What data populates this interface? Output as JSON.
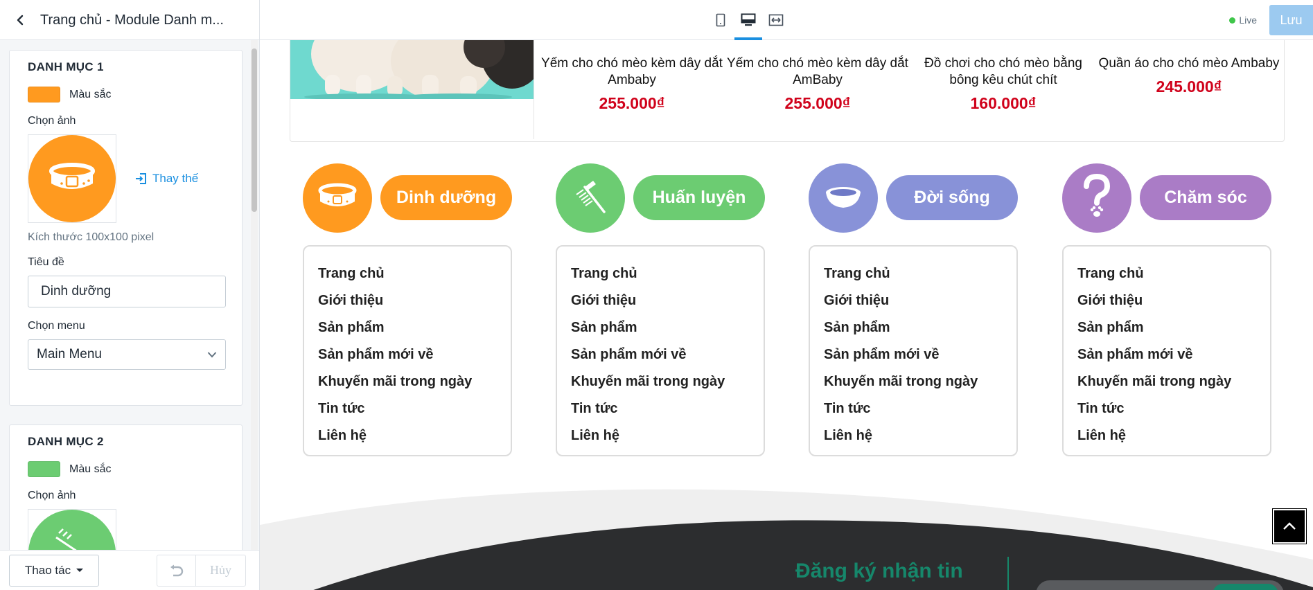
{
  "topbar": {
    "title": "Trang chủ - Module Danh m...",
    "live_label": "Live",
    "save_label": "Lưu"
  },
  "sidebar": {
    "category1": {
      "heading": "DANH MỤC 1",
      "color": "#ff9a1f",
      "color_label": "Màu sắc",
      "image_label": "Chọn ảnh",
      "replace_label": "Thay thế",
      "size_hint": "Kích thước 100x100 pixel",
      "title_label": "Tiêu đề",
      "title_value": "Dinh dưỡng",
      "menu_label": "Chọn menu",
      "menu_value": "Main Menu"
    },
    "category2": {
      "heading": "DANH MỤC 2",
      "color": "#6ccc72",
      "color_label": "Màu sắc",
      "image_label": "Chọn ảnh"
    },
    "footer": {
      "actions_label": "Thao tác",
      "cancel_label": "Hủy"
    }
  },
  "preview": {
    "products": [
      {
        "name": "Yếm cho chó mèo kèm dây dắt Ambaby",
        "price": "255.000₫"
      },
      {
        "name": "Yếm cho chó mèo kèm dây dắt AmBaby",
        "price": "255.000₫"
      },
      {
        "name": "Đồ chơi cho chó mèo bằng bông kêu chút chít",
        "price": "160.000₫"
      },
      {
        "name": "Quần áo cho chó mèo Ambaby",
        "price": "245.000₫"
      }
    ],
    "categories": [
      {
        "title": "Dinh dưỡng",
        "color": "#ff9a1f",
        "icon": "collar-icon",
        "menu": [
          "Trang chủ",
          "Giới thiệu",
          "Sản phẩm",
          "Sản phẩm mới về",
          "Khuyến mãi trong ngày",
          "Tin tức",
          "Liên hệ"
        ]
      },
      {
        "title": "Huấn luyện",
        "color": "#6ccc72",
        "icon": "comb-icon",
        "menu": [
          "Trang chủ",
          "Giới thiệu",
          "Sản phẩm",
          "Sản phẩm mới về",
          "Khuyến mãi trong ngày",
          "Tin tức",
          "Liên hệ"
        ]
      },
      {
        "title": "Đời sống",
        "color": "#8892d8",
        "icon": "bowl-icon",
        "menu": [
          "Trang chủ",
          "Giới thiệu",
          "Sản phẩm",
          "Sản phẩm mới về",
          "Khuyến mãi trong ngày",
          "Tin tức",
          "Liên hệ"
        ]
      },
      {
        "title": "Chăm sóc",
        "color": "#aa7cc6",
        "icon": "question-paw-icon",
        "menu": [
          "Trang chủ",
          "Giới thiệu",
          "Sản phẩm",
          "Sản phẩm mới về",
          "Khuyến mãi trong ngày",
          "Tin tức",
          "Liên hệ"
        ]
      }
    ],
    "newsletter_title": "Đăng ký nhận tin"
  }
}
